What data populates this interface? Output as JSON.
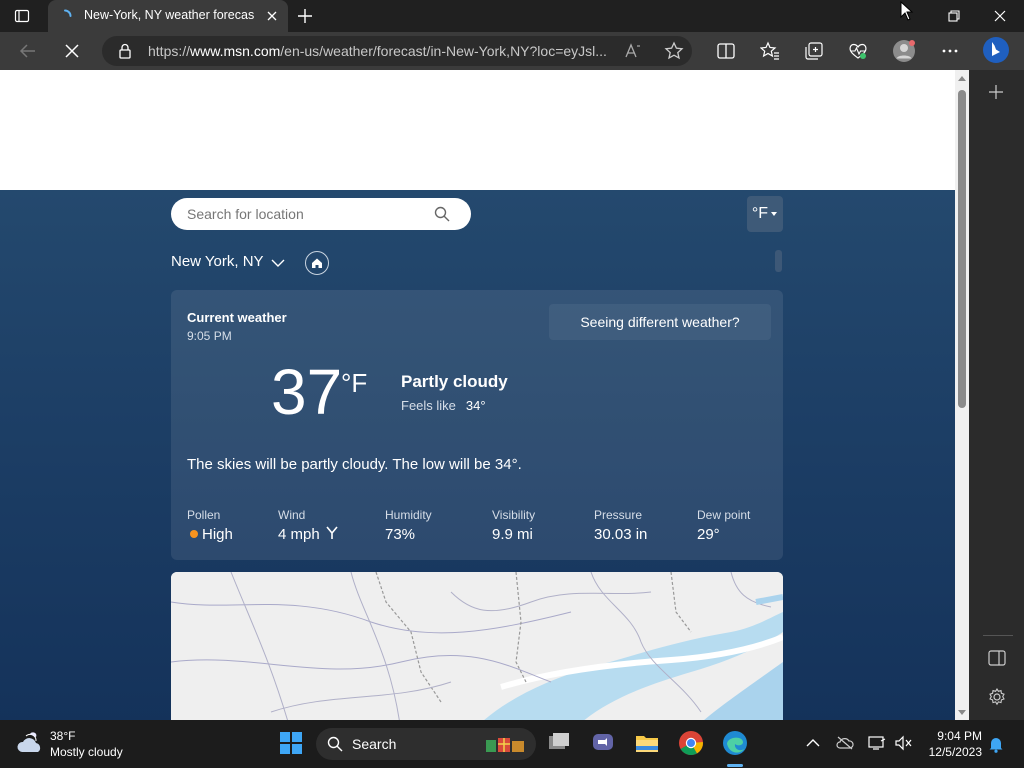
{
  "browser": {
    "tab_title": "New-York, NY weather forecast |",
    "url_prefix": "https://",
    "url_host": "www.msn.com",
    "url_path": "/en-us/weather/forecast/in-New-York,NY?loc=eyJsl..."
  },
  "weather": {
    "search_placeholder": "Search for location",
    "unit_toggle": "°F",
    "location": "New York, NY",
    "current_label": "Current weather",
    "time": "9:05 PM",
    "different_weather": "Seeing different weather?",
    "temperature": "37",
    "temperature_unit": "°F",
    "condition": "Partly cloudy",
    "feels_like_label": "Feels like",
    "feels_like_value": "34°",
    "summary": "The skies will be partly cloudy. The low will be 34°.",
    "metrics": [
      {
        "label": "Pollen",
        "value": "High"
      },
      {
        "label": "Wind",
        "value": "4 mph"
      },
      {
        "label": "Humidity",
        "value": "73%"
      },
      {
        "label": "Visibility",
        "value": "9.9 mi"
      },
      {
        "label": "Pressure",
        "value": "30.03 in"
      },
      {
        "label": "Dew point",
        "value": "29°"
      }
    ]
  },
  "taskbar": {
    "weather_temp": "38°F",
    "weather_desc": "Mostly cloudy",
    "search_label": "Search",
    "time": "9:04 PM",
    "date": "12/5/2023"
  },
  "colors": {
    "pollen_high": "#f7931e",
    "page_gradient_top": "#24496e",
    "page_gradient_bottom": "#14325a",
    "edge_accent": "#1f8ad2"
  }
}
